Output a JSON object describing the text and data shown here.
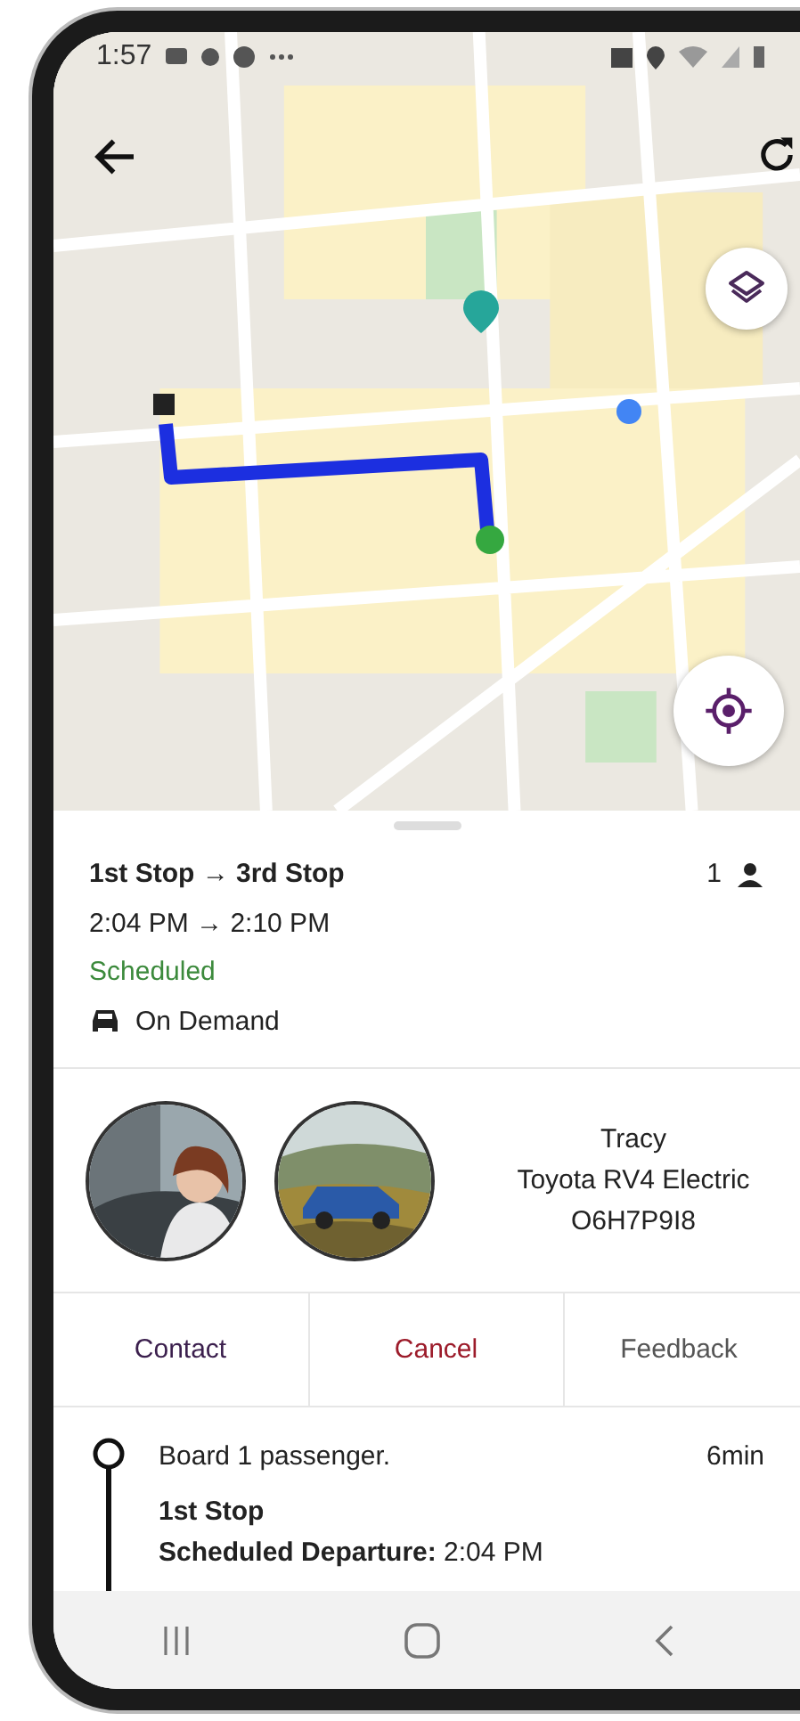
{
  "status_bar": {
    "time": "1:57"
  },
  "trip": {
    "title": "1st Stop → 3rd Stop",
    "passengers": "1",
    "times": "2:04 PM → 2:10 PM",
    "status": "Scheduled",
    "service": "On Demand"
  },
  "driver": {
    "name": "Tracy",
    "vehicle": "Toyota RV4 Electric",
    "plate": "O6H7P9I8"
  },
  "actions": [
    {
      "label": "Contact",
      "kind": "contact"
    },
    {
      "label": "Cancel",
      "kind": "danger"
    },
    {
      "label": "Feedback",
      "kind": "neutral"
    }
  ],
  "timeline": [
    {
      "note": "Board 1 passenger.",
      "duration": "6min",
      "stop": "1st Stop",
      "detail": "**Scheduled Departure:** 2:04 PM"
    }
  ]
}
